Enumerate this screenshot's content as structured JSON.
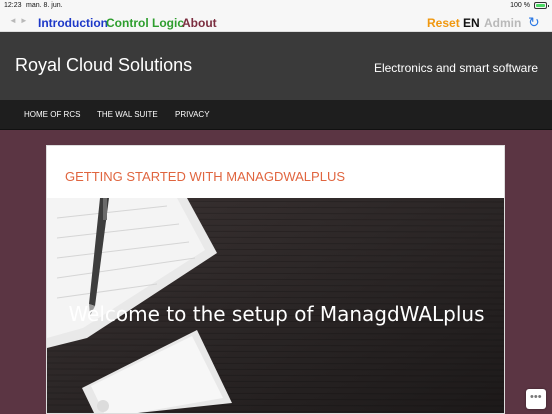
{
  "status_bar": {
    "time": "12:23",
    "date": "man. 8. jun.",
    "battery_pct": "100 %"
  },
  "toolbar": {
    "back_icon": "back-arrow-icon",
    "forward_icon": "forward-arrow-icon",
    "tabs": [
      {
        "label": "Introduction",
        "color": "#1d38c8"
      },
      {
        "label": "Control Logic",
        "color": "#2e9e2e"
      },
      {
        "label": "About",
        "color": "#7b2d3f"
      }
    ],
    "reset_label": "Reset",
    "language_label": "EN",
    "admin_label": "Admin",
    "refresh_icon": "refresh-icon"
  },
  "site": {
    "title": "Royal Cloud Solutions",
    "tagline": "Electronics and smart software"
  },
  "nav": {
    "items": [
      {
        "label": "HOME OF RCS"
      },
      {
        "label": "THE WAL SUITE"
      },
      {
        "label": "PRIVACY"
      }
    ]
  },
  "post": {
    "title": "GETTING STARTED WITH MANAGDWALPLUS",
    "hero_text": "Welcome to the setup of ManagdWALplus"
  },
  "colors": {
    "page_bg": "#5b3543",
    "header_bg": "#3a3a3a",
    "nav_bg": "#1e1e1e",
    "post_title": "#e0653f",
    "reset": "#f0980f",
    "admin": "#b9b9b9"
  }
}
